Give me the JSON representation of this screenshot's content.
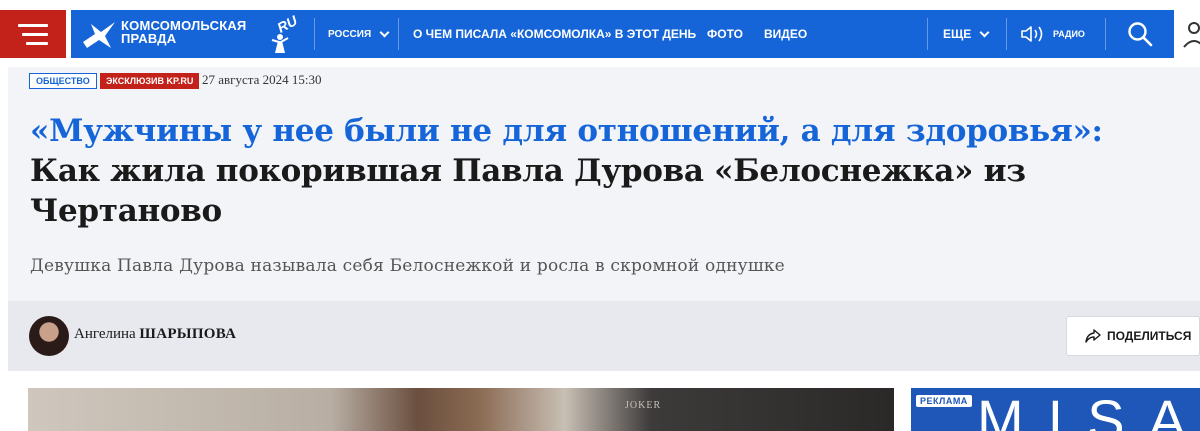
{
  "header": {
    "logo_line1": "КОМСОМОЛЬСКАЯ",
    "logo_line2": "ПРАВДА",
    "logo_ru": "RU",
    "region": "РОССИЯ",
    "nav": [
      "О ЧЕМ ПИСАЛА «КОМСОМОЛКА» В ЭТОТ ДЕНЬ",
      "ФОТО",
      "ВИДЕО"
    ],
    "more": "ЕЩЕ",
    "radio": "РАДИО",
    "colors": {
      "brand_blue": "#1565d8",
      "brand_red": "#c3221b"
    }
  },
  "article": {
    "tags": [
      "ОБЩЕСТВО",
      "ЭКСКЛЮЗИВ KP.RU"
    ],
    "date": "27 августа 2024 15:30",
    "headline_quote": "«Мужчины у нее были не для отношений, а для здоровья»:",
    "headline_rest": "Как жила покорившая Павла Дурова «Белоснежка» из Чертаново",
    "lead": "Девушка Павла Дурова называла себя Белоснежкой и росла в скромной однушке"
  },
  "author": {
    "first_name": "Ангелина",
    "last_name": "ШАРЫПОВА"
  },
  "share": {
    "label": "ПОДЕЛИТЬСЯ"
  },
  "photo": {
    "sign_text": "JOKER"
  },
  "ad": {
    "label": "РЕКЛАМА",
    "text": "MISA"
  }
}
